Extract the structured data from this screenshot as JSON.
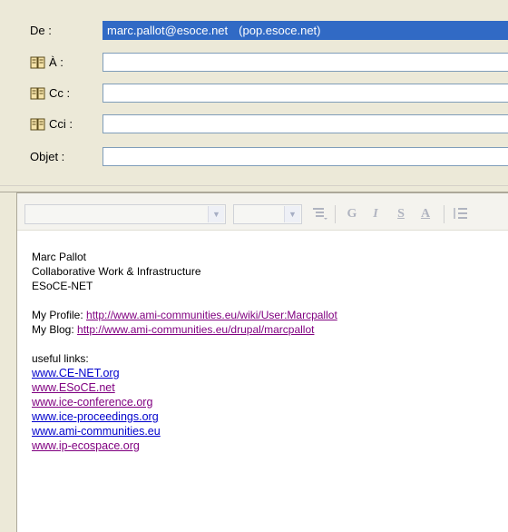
{
  "header": {
    "from_label": "De :",
    "from_address": "marc.pallot@esoce.net",
    "from_account": "(pop.esoce.net)",
    "to_label": "À :",
    "cc_label": "Cc :",
    "bcc_label": "Cci :",
    "subject_label": "Objet :"
  },
  "toolbar": {
    "bold": "G",
    "italic": "I",
    "strike": "S",
    "color": "A"
  },
  "body": {
    "name": "Marc Pallot",
    "role": "Collaborative Work & Infrastructure",
    "org": "ESoCE-NET",
    "profile_label": "My Profile:",
    "profile_url": "http://www.ami-communities.eu/wiki/User:Marcpallot",
    "blog_label": "My Blog:",
    "blog_url": "http://www.ami-communities.eu/drupal/marcpallot",
    "links_label": "useful links:",
    "links": [
      "www.CE-NET.org",
      "www.ESoCE.net",
      "www.ice-conference.org",
      "www.ice-proceedings.org",
      "www.ami-communities.eu",
      "www.ip-ecospace.org"
    ]
  }
}
